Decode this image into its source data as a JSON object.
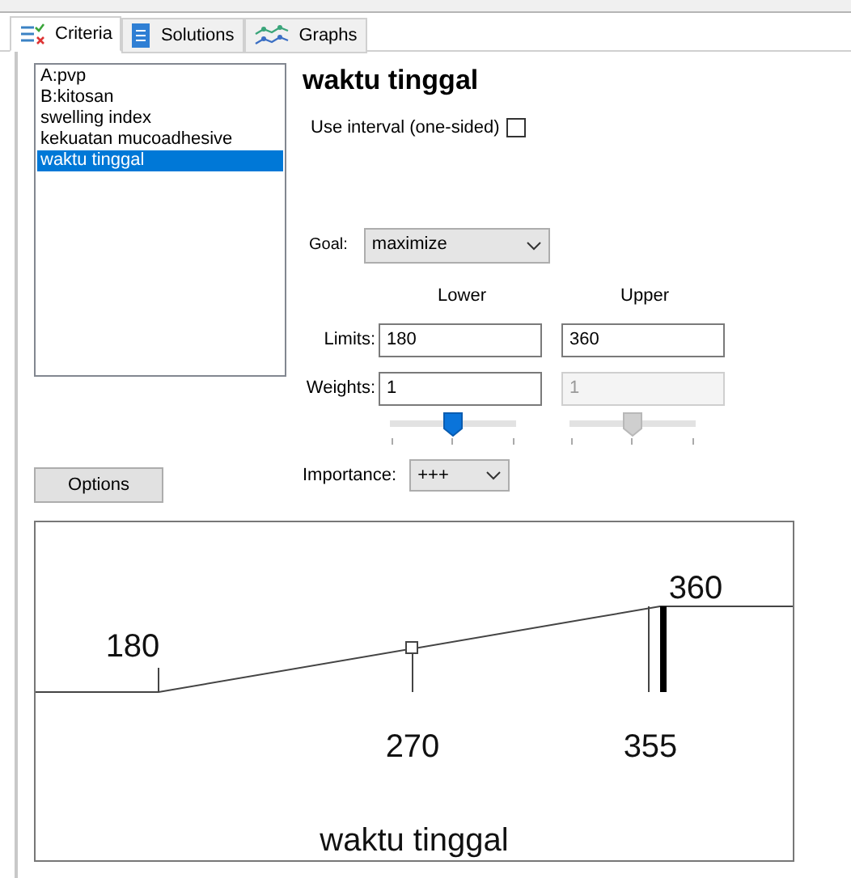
{
  "tabs": [
    {
      "label": "Criteria",
      "selected": true
    },
    {
      "label": "Solutions",
      "selected": false
    },
    {
      "label": "Graphs",
      "selected": false
    }
  ],
  "criteria_list": [
    {
      "label": "A:pvp",
      "selected": false
    },
    {
      "label": "B:kitosan",
      "selected": false
    },
    {
      "label": "swelling index",
      "selected": false
    },
    {
      "label": "kekuatan mucoadhesive",
      "selected": false
    },
    {
      "label": "waktu tinggal",
      "selected": true
    }
  ],
  "title": "waktu tinggal",
  "use_interval": {
    "label": "Use interval (one-sided)",
    "checked": false
  },
  "goal": {
    "label": "Goal:",
    "value": "maximize"
  },
  "columns": [
    "Lower",
    "Upper"
  ],
  "limits": {
    "label": "Limits:",
    "lower": "180",
    "upper": "360"
  },
  "weights": {
    "label": "Weights:",
    "lower": "1",
    "upper": "1",
    "upper_disabled": true
  },
  "weight_sliders": [
    {
      "level": 0.5,
      "disabled": false
    },
    {
      "level": 0.5,
      "disabled": true
    }
  ],
  "options_button": "Options",
  "importance": {
    "label": "Importance:",
    "value": "+++"
  },
  "desirability_plot": {
    "lower_label": "180",
    "mid_label": "270",
    "current_label": "355",
    "upper_label": "360",
    "title": "waktu tinggal"
  }
}
